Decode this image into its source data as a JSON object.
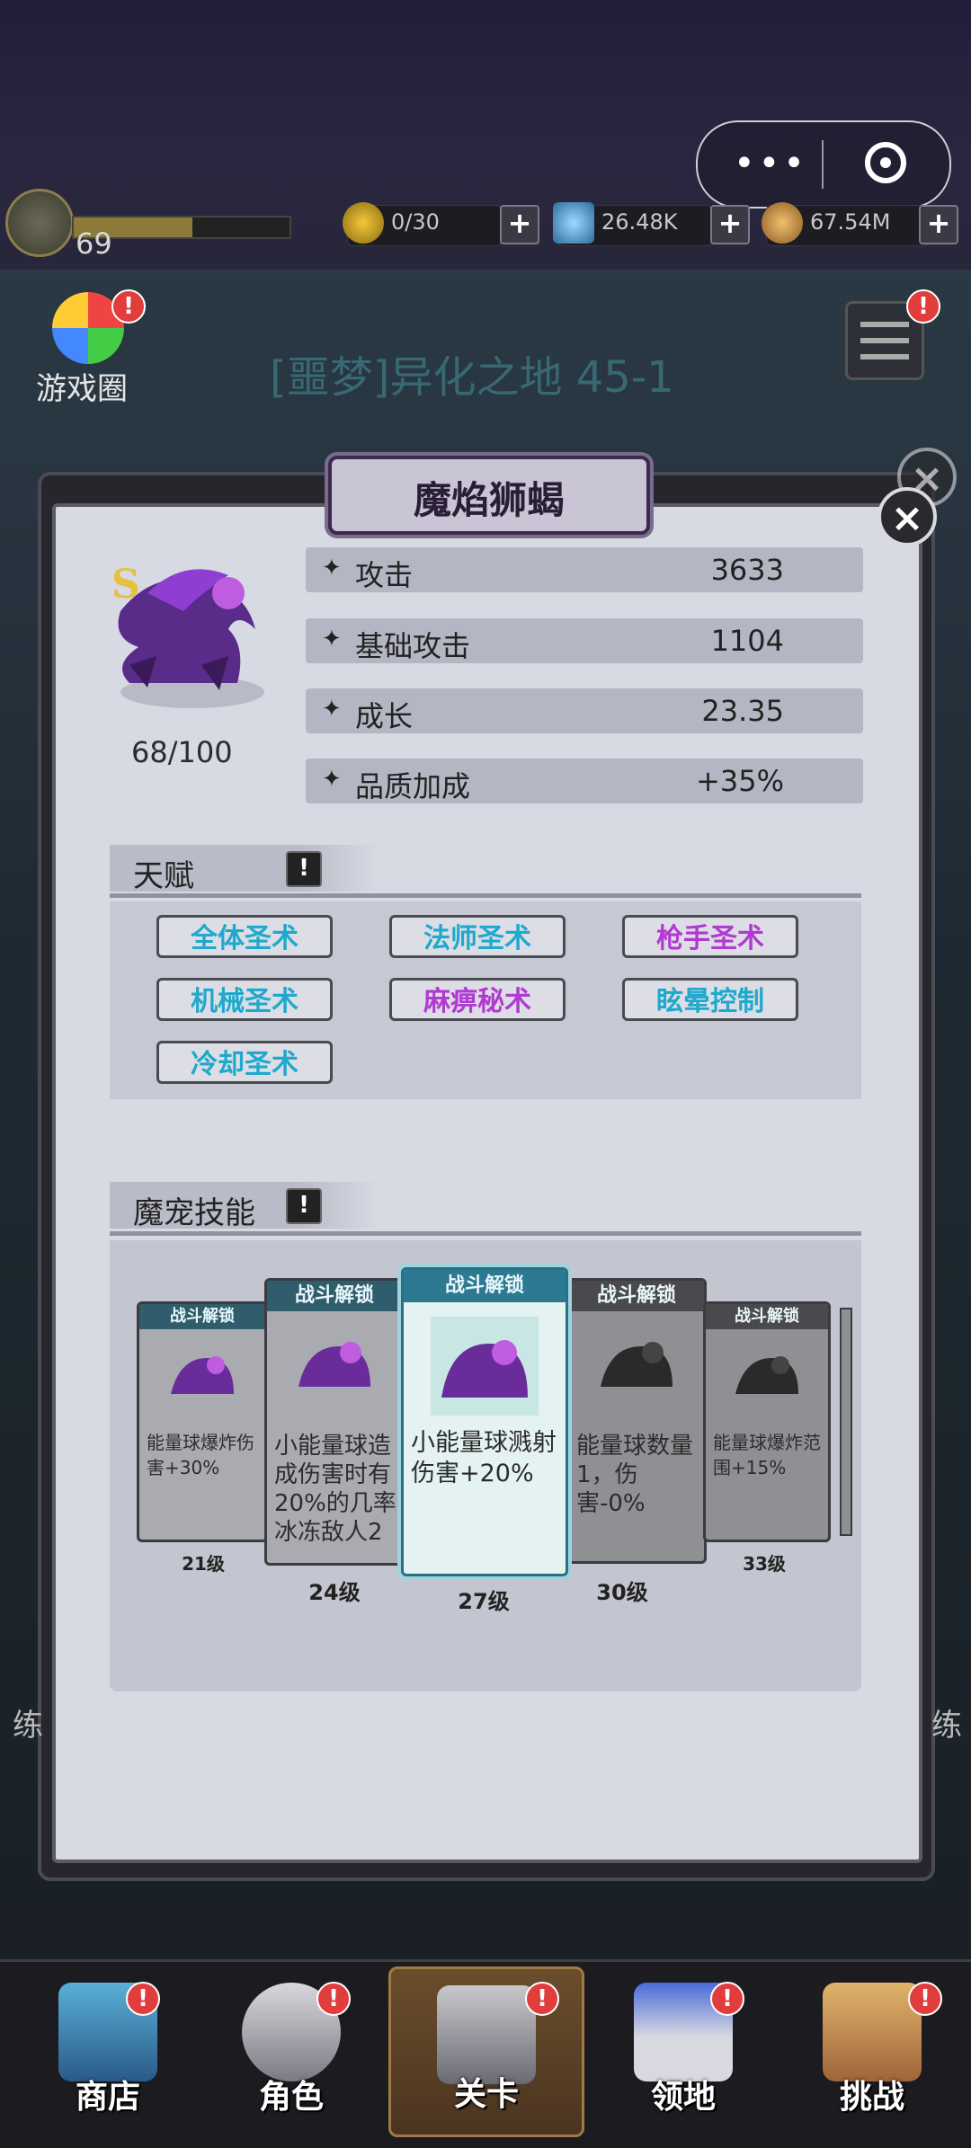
{
  "status": {
    "level": "69",
    "energy": "0/30",
    "gems": "26.48K",
    "coins": "67.54M"
  },
  "header": {
    "game_circle_label": "游戏圈",
    "stage_title": "[噩梦]异化之地 45-1",
    "badge": "!"
  },
  "dialog": {
    "title": "魔焰狮蝎",
    "pet_count": "68/100",
    "stats": [
      {
        "label": "攻击",
        "value": "3633"
      },
      {
        "label": "基础攻击",
        "value": "1104"
      },
      {
        "label": "成长",
        "value": "23.35"
      },
      {
        "label": "品质加成",
        "value": "+35%"
      }
    ],
    "talent_title": "天赋",
    "talents": [
      {
        "label": "全体圣术",
        "color": "#1fa9cc"
      },
      {
        "label": "法师圣术",
        "color": "#1fa9cc"
      },
      {
        "label": "枪手圣术",
        "color": "#b13ad0"
      },
      {
        "label": "机械圣术",
        "color": "#1fa9cc"
      },
      {
        "label": "麻痹秘术",
        "color": "#b13ad0"
      },
      {
        "label": "眩晕控制",
        "color": "#1fa9cc"
      },
      {
        "label": "冷却圣术",
        "color": "#1fa9cc"
      }
    ],
    "skills_title": "魔宠技能",
    "skill_header": "战斗解锁",
    "skills": [
      {
        "desc": "能量球爆炸伤害+30%",
        "level": "21级"
      },
      {
        "desc": "小能量球造成伤害时有20%的几率冰冻敌人2",
        "level": "24级"
      },
      {
        "desc": "小能量球溅射伤害+20%",
        "level": "27级"
      },
      {
        "desc": "能量球数量1，伤害-0%",
        "level": "30级"
      },
      {
        "desc": "能量球爆炸范围+15%",
        "level": "33级"
      }
    ]
  },
  "nav": [
    {
      "label": "商店"
    },
    {
      "label": "角色"
    },
    {
      "label": "关卡"
    },
    {
      "label": "领地"
    },
    {
      "label": "挑战"
    }
  ],
  "side": {
    "left": "练",
    "right": "练"
  },
  "colors": {
    "accent_blue": "#1fa9cc",
    "accent_purple": "#b13ad0",
    "badge_red": "#e23d3d"
  }
}
